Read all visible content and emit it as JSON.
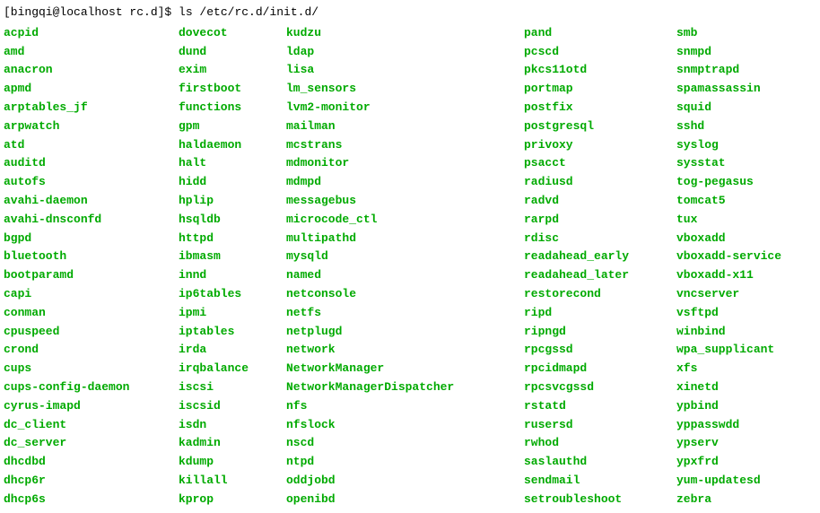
{
  "prompt": {
    "full": "[bingqi@localhost rc.d]$ ls /etc/rc.d/init.d/"
  },
  "columns": [
    [
      "acpid",
      "amd",
      "anacron",
      "apmd",
      "arptables_jf",
      "arpwatch",
      "atd",
      "auditd",
      "autofs",
      "avahi-daemon",
      "avahi-dnsconfd",
      "bgpd",
      "bluetooth",
      "bootparamd",
      "capi",
      "conman",
      "cpuspeed",
      "crond",
      "cups",
      "cups-config-daemon",
      "cyrus-imapd",
      "dc_client",
      "dc_server",
      "dhcdbd",
      "dhcp6r",
      "dhcp6s"
    ],
    [
      "dovecot",
      "dund",
      "exim",
      "firstboot",
      "functions",
      "gpm",
      "haldaemon",
      "halt",
      "hidd",
      "hplip",
      "hsqldb",
      "httpd",
      "ibmasm",
      "innd",
      "ip6tables",
      "ipmi",
      "iptables",
      "irda",
      "irqbalance",
      "iscsi",
      "iscsid",
      "isdn",
      "kadmin",
      "kdump",
      "killall",
      "kprop"
    ],
    [
      "kudzu",
      "ldap",
      "lisa",
      "lm_sensors",
      "lvm2-monitor",
      "mailman",
      "mcstrans",
      "mdmonitor",
      "mdmpd",
      "messagebus",
      "microcode_ctl",
      "multipathd",
      "mysqld",
      "named",
      "netconsole",
      "netfs",
      "netplugd",
      "network",
      "NetworkManager",
      "NetworkManagerDispatcher",
      "nfs",
      "nfslock",
      "nscd",
      "ntpd",
      "oddjobd",
      "openibd"
    ],
    [
      "pand",
      "pcscd",
      "pkcs11otd",
      "portmap",
      "postfix",
      "postgresql",
      "privoxy",
      "psacct",
      "radiusd",
      "radvd",
      "rarpd",
      "rdisc",
      "readahead_early",
      "readahead_later",
      "restorecond",
      "ripd",
      "ripngd",
      "rpcgssd",
      "rpcidmapd",
      "rpcsvcgssd",
      "rstatd",
      "rusersd",
      "rwhod",
      "saslauthd",
      "sendmail",
      "setroubleshoot"
    ],
    [
      "smb",
      "snmpd",
      "snmptrapd",
      "spamassassin",
      "squid",
      "sshd",
      "syslog",
      "sysstat",
      "tog-pegasus",
      "tomcat5",
      "tux",
      "vboxadd",
      "vboxadd-service",
      "vboxadd-x11",
      "vncserver",
      "vsftpd",
      "winbind",
      "wpa_supplicant",
      "xfs",
      "xinetd",
      "ypbind",
      "yppasswdd",
      "ypserv",
      "ypxfrd",
      "yum-updatesd",
      "zebra"
    ]
  ]
}
